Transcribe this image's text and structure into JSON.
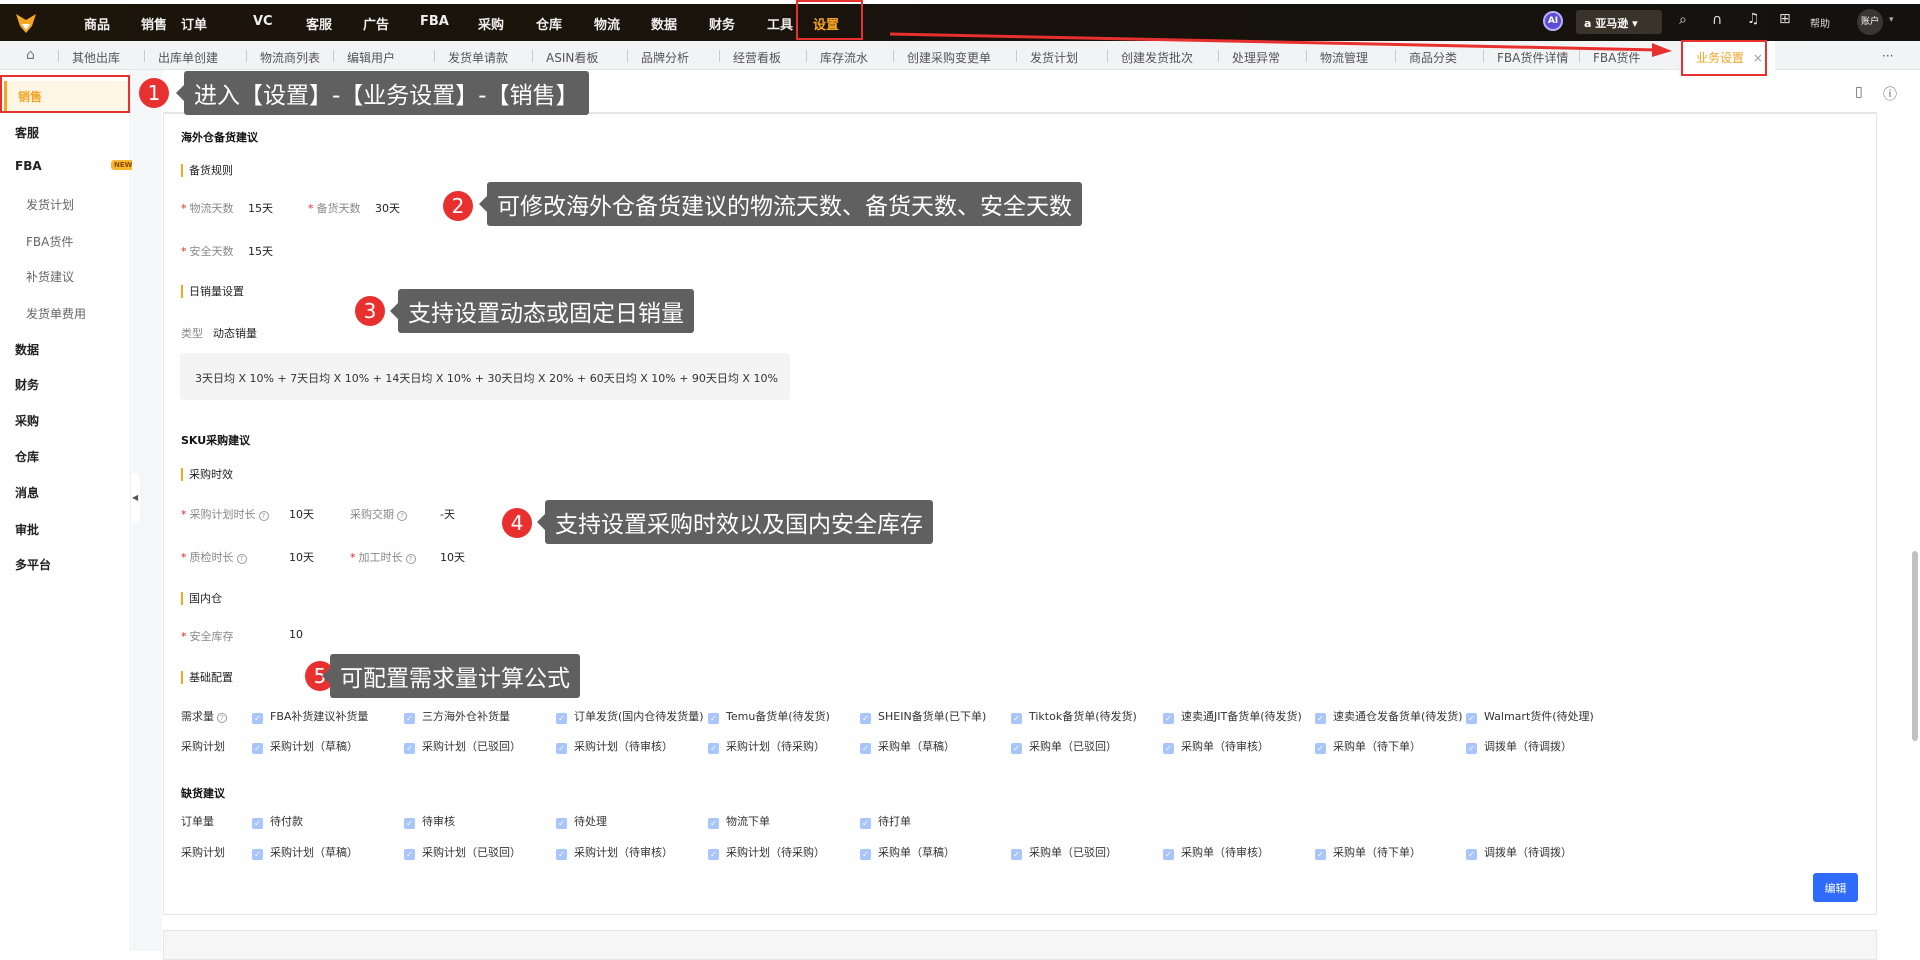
{
  "topnav": {
    "items": [
      "商品",
      "销售",
      "订单",
      "VC",
      "客服",
      "广告",
      "FBA",
      "采购",
      "仓库",
      "物流",
      "数据",
      "财务",
      "工具",
      "设置"
    ],
    "active": "设置",
    "ai_label": "AI",
    "store": "亚马逊",
    "help": "帮助",
    "account": "账户"
  },
  "tabs": {
    "items": [
      "其他出库",
      "出库单创建",
      "物流商列表",
      "编辑用户",
      "发货单请款",
      "ASIN看板",
      "品牌分析",
      "经营看板",
      "库存流水",
      "创建采购变更单",
      "发货计划",
      "创建发货批次",
      "处理异常",
      "物流管理",
      "商品分类",
      "FBA货件详情",
      "FBA货件"
    ],
    "active": "业务设置",
    "more": "···",
    "close": "×"
  },
  "sidebar": {
    "items": [
      {
        "label": "销售",
        "active": true
      },
      {
        "label": "客服"
      },
      {
        "label": "FBA",
        "badge": "NEW"
      },
      {
        "label": "发货计划",
        "sub": true
      },
      {
        "label": "FBA货件",
        "sub": true
      },
      {
        "label": "补货建议",
        "sub": true
      },
      {
        "label": "发货单费用",
        "sub": true
      },
      {
        "label": "数据"
      },
      {
        "label": "财务"
      },
      {
        "label": "采购"
      },
      {
        "label": "仓库"
      },
      {
        "label": "消息"
      },
      {
        "label": "审批"
      },
      {
        "label": "多平台"
      }
    ]
  },
  "overseas": {
    "title": "海外仓备货建议",
    "rule_title": "备货规则",
    "logistics_label": "物流天数",
    "logistics_value": "15天",
    "stock_label": "备货天数",
    "stock_value": "30天",
    "safety_label": "安全天数",
    "safety_value": "15天",
    "daily_title": "日销量设置",
    "type_label": "类型",
    "type_value": "动态销量",
    "formula": "3天日均 X 10% + 7天日均 X 10% + 14天日均 X 10% + 30天日均 X 20% + 60天日均 X 10% + 90天日均 X 10%"
  },
  "sku": {
    "title": "SKU采购建议",
    "timing_title": "采购时效",
    "plan_label": "采购计划时长",
    "plan_value": "10天",
    "delivery_label": "采购交期",
    "delivery_value": "-天",
    "qc_label": "质检时长",
    "qc_value": "10天",
    "process_label": "加工时长",
    "process_value": "10天",
    "domestic_title": "国内仓",
    "safety_stock_label": "安全库存",
    "safety_stock_value": "10",
    "basic_title": "基础配置",
    "demand_label": "需求量",
    "demand_items": [
      "FBA补货建议补货量",
      "三方海外仓补货量",
      "订单发货(国内仓待发货量)",
      "Temu备货单(待发货)",
      "SHEIN备货单(已下单)",
      "Tiktok备货单(待发货)",
      "速卖通JIT备货单(待发货)",
      "速卖通仓发备货单(待发货)",
      "Walmart货件(待处理)"
    ],
    "purchase_label": "采购计划",
    "purchase_items": [
      "采购计划（草稿）",
      "采购计划（已驳回）",
      "采购计划（待审核）",
      "采购计划（待采购）",
      "采购单（草稿）",
      "采购单（已驳回）",
      "采购单（待审核）",
      "采购单（待下单）",
      "调拨单（待调拨）"
    ]
  },
  "shortage": {
    "title": "缺货建议",
    "order_label": "订单量",
    "order_items": [
      "待付款",
      "待审核",
      "待处理",
      "物流下单",
      "待打单"
    ],
    "purchase_label": "采购计划",
    "purchase_items": [
      "采购计划（草稿）",
      "采购计划（已驳回）",
      "采购计划（待审核）",
      "采购计划（待采购）",
      "采购单（草稿）",
      "采购单（已驳回）",
      "采购单（待审核）",
      "采购单（待下单）",
      "调拨单（待调拨）"
    ]
  },
  "edit_button": "编辑",
  "callouts": [
    {
      "num": "1",
      "text": "进入【设置】-【业务设置】-【销售】"
    },
    {
      "num": "2",
      "text": "可修改海外仓备货建议的物流天数、备货天数、安全天数"
    },
    {
      "num": "3",
      "text": "支持设置动态或固定日销量"
    },
    {
      "num": "4",
      "text": "支持设置采购时效以及国内安全库存"
    },
    {
      "num": "5",
      "text": "可配置需求量计算公式"
    }
  ],
  "colors": {
    "accent": "#f5a623",
    "primary": "#2f6bff",
    "annotation": "#e8312f"
  }
}
